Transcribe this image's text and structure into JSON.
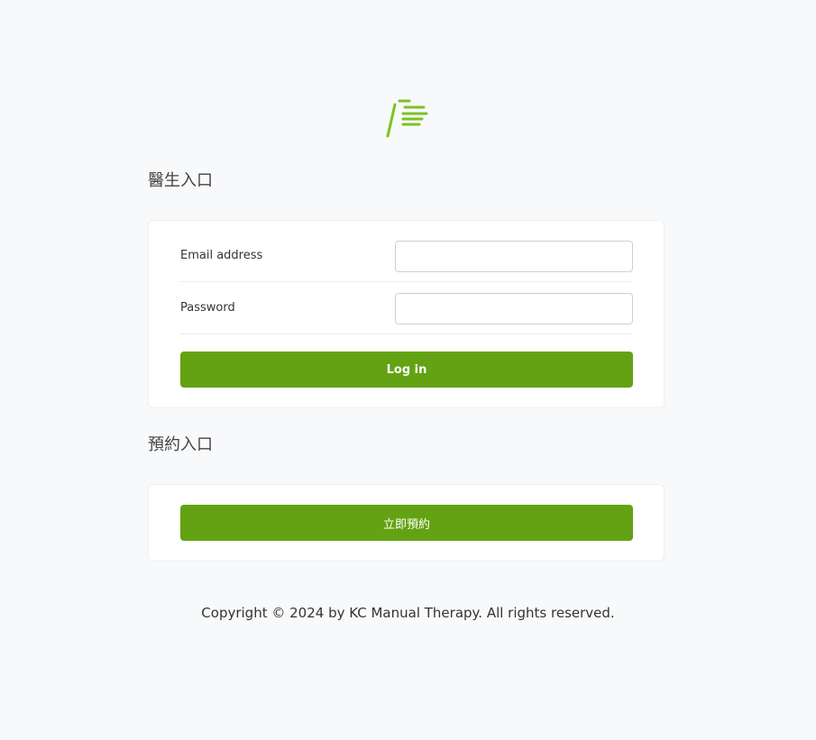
{
  "brand": {
    "logo_icon": "slash-lines-logo-icon",
    "accent_color": "#7cc321"
  },
  "doctor_portal": {
    "title": "醫生入口",
    "email_label": "Email address",
    "email_value": "",
    "password_label": "Password",
    "password_value": "",
    "login_label": "Log in"
  },
  "booking_portal": {
    "title": "預約入口",
    "book_now_label": "立即預約"
  },
  "footer": {
    "copyright": "Copyright © 2024 by KC Manual Therapy. All rights reserved."
  },
  "colors": {
    "button": "#63a212",
    "background": "#f8f9fa",
    "card": "#ffffff"
  }
}
